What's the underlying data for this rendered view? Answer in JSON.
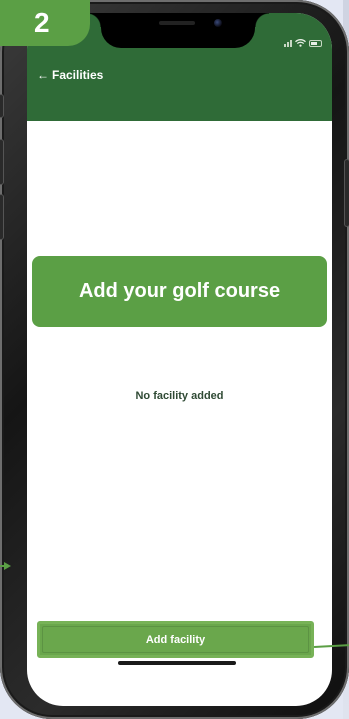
{
  "step": {
    "number": "2"
  },
  "callout": {
    "text": "Add your golf course"
  },
  "header": {
    "back_label": "Facilities",
    "back_icon": "arrow-left-icon"
  },
  "content": {
    "empty_text": "No facility added"
  },
  "footer": {
    "add_button_label": "Add facility"
  },
  "colors": {
    "header": "#2f6b37",
    "accent": "#5b9f45",
    "button": "#6aa74c",
    "screen_bg": "#ffffff"
  }
}
